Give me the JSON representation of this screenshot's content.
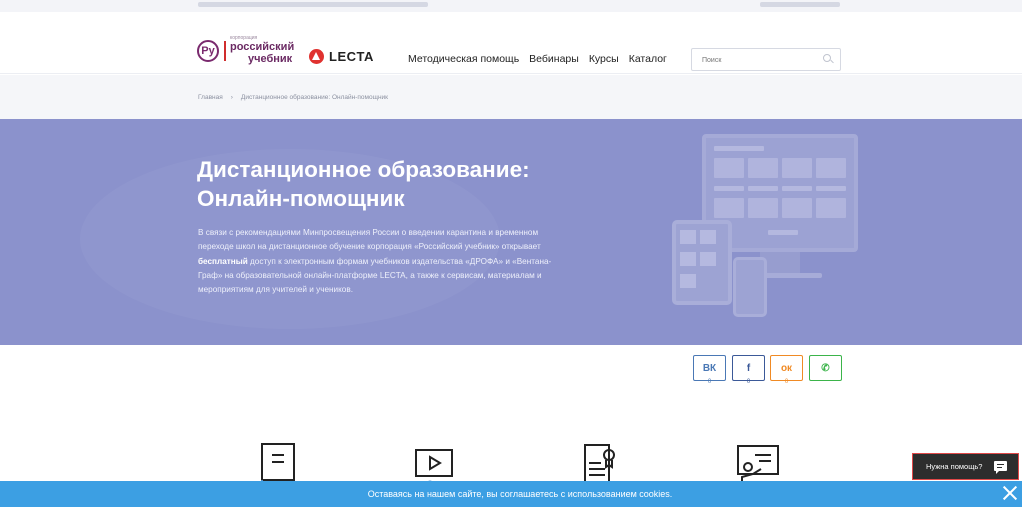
{
  "header": {
    "logo_ru": {
      "small": "корпорация",
      "line1": "российский",
      "line2": "учебник",
      "mark": "Ру"
    },
    "logo_lecta": "LECTA",
    "nav": [
      "Методическая помощь",
      "Вебинары",
      "Курсы",
      "Каталог"
    ],
    "search_placeholder": "Поиск"
  },
  "breadcrumb": {
    "home": "Главная",
    "separator": "›",
    "current": "Дистанционное образование: Онлайн-помощник"
  },
  "hero": {
    "title_line1": "Дистанционное образование:",
    "title_line2": "Онлайн-помощник",
    "text_before": "В связи с рекомендациями Минпросвещения России о введении карантина и временном переходе школ на дистанционное обучение корпорация «Российский учебник» открывает ",
    "text_bold": "бесплатный",
    "text_after": " доступ к электронным формам учебников издательства «ДРОФА» и «Вентана-Граф» на образовательной онлайн-платформе LECTA, а также к сервисам, материалам и мероприятиям для учителей и учеников."
  },
  "share": [
    {
      "name": "vk",
      "label": "ВК",
      "count": "0",
      "color": "#4a78b5"
    },
    {
      "name": "facebook",
      "label": "f",
      "count": "0",
      "color": "#3b5998"
    },
    {
      "name": "odnoklassniki",
      "label": "ок",
      "count": "0",
      "color": "#f08a24"
    },
    {
      "name": "whatsapp",
      "label": "✆",
      "count": "",
      "color": "#3bb44a"
    }
  ],
  "help_label": "Нужна помощь?",
  "cookie_text": "Оставаясь на нашем сайте, вы соглашаетесь с использованием cookies.",
  "colors": {
    "hero": "#8b92cc",
    "cookie": "#3c9fe3",
    "help_border": "#e04848"
  }
}
